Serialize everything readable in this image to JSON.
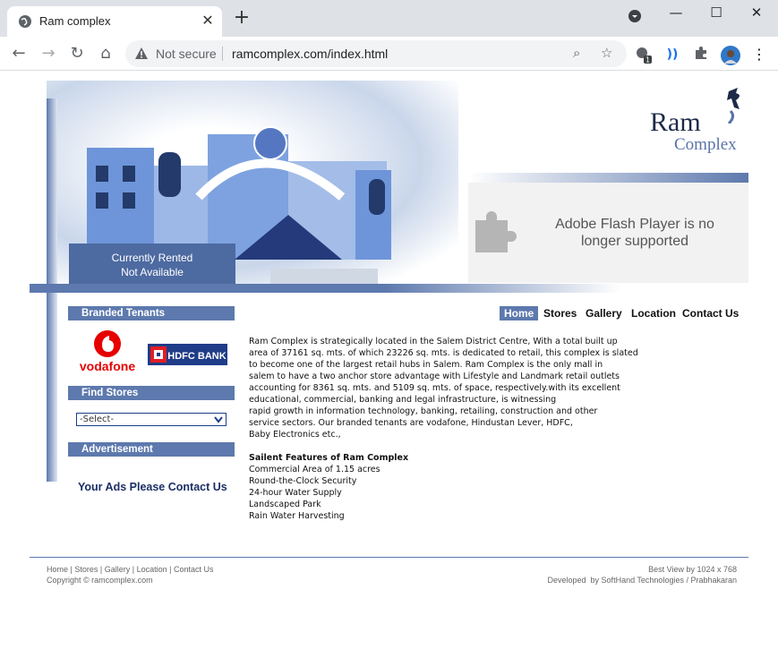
{
  "browser": {
    "tab_title": "Ram complex",
    "new_tab": "+",
    "security_label": "Not secure",
    "url": "ramcomplex.com/index.html",
    "extension_badge": "1"
  },
  "logo": {
    "line1": "Ram",
    "line2": "Complex"
  },
  "banner": {
    "rented_line1": "Currently Rented",
    "rented_line2": "Not Available"
  },
  "flash": {
    "message": "Adobe Flash Player is no longer supported"
  },
  "sidebar": {
    "branded_tenants": "Branded Tenants",
    "vodafone": "vodafone",
    "hdfc": "HDFC BANK",
    "find_stores": "Find Stores",
    "select_value": "-Select-",
    "advertisement": "Advertisement",
    "ads_text": "Your Ads Please Contact Us"
  },
  "nav": [
    {
      "label": "Home"
    },
    {
      "label": "Stores"
    },
    {
      "label": "Gallery"
    },
    {
      "label": "Location"
    },
    {
      "label": "Contact Us"
    }
  ],
  "content": {
    "lines": [
      "Ram Complex is strategically located in the Salem District Centre, With a total built up",
      "area of 37161 sq. mts. of which 23226 sq. mts. is dedicated to retail, this complex is slated",
      "to become one of the largest retail hubs in Salem. Ram Complex is the only mall in",
      "salem to have a two anchor store advantage with Lifestyle and Landmark retail outlets",
      "accounting for 8361 sq. mts. and 5109 sq. mts. of space, respectively.with its excellent",
      "educational, commercial, banking and legal infrastructure, is witnessing",
      "rapid growth in information technology, banking, retailing, construction and other",
      "service sectors. Our branded tenants are vodafone, Hindustan Lever, HDFC,",
      "Baby Electronics etc.,"
    ],
    "features_title": "Sailent Features of Ram Complex",
    "features": [
      "Commercial Area of 1.15 acres",
      "Round-the-Clock Security",
      "24-hour Water Supply",
      "Landscaped Park",
      "Rain Water Harvesting"
    ]
  },
  "footer": {
    "links": [
      "Home",
      "Stores",
      "Gallery",
      "Location",
      "Contact Us"
    ],
    "separator": " | ",
    "copyright": "Copyright © ramcomplex.com",
    "best_view": "Best View by 1024 x 768",
    "developed": "Developed  by SoftHand Technologies / Prabhakaran"
  },
  "colors": {
    "accent": "#5d79ad",
    "navy": "#1c2e66"
  }
}
